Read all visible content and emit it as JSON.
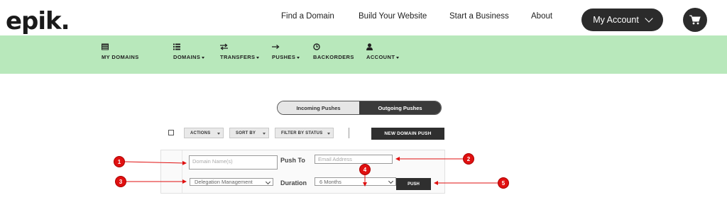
{
  "header": {
    "logo": "epik.",
    "nav": [
      "Find a Domain",
      "Build Your Website",
      "Start a Business",
      "About"
    ],
    "account_label": "My Account"
  },
  "band": {
    "items": [
      {
        "label": "MY DOMAINS",
        "icon": "list-icon",
        "dropdown": false
      },
      {
        "label": "DOMAINS",
        "icon": "list-icon",
        "dropdown": true
      },
      {
        "label": "TRANSFERS",
        "icon": "transfer-icon",
        "dropdown": true
      },
      {
        "label": "PUSHES",
        "icon": "arrow-right-icon",
        "dropdown": true
      },
      {
        "label": "BACKORDERS",
        "icon": "clock-icon",
        "dropdown": false
      },
      {
        "label": "ACCOUNT",
        "icon": "user-icon",
        "dropdown": true
      }
    ]
  },
  "tabs": {
    "incoming": "Incoming Pushes",
    "outgoing": "Outgoing Pushes"
  },
  "toolbar": {
    "actions": "ACTIONS",
    "sort_by": "SORT BY",
    "filter": "FILTER BY STATUS",
    "new_push": "NEW DOMAIN PUSH"
  },
  "form": {
    "domain_placeholder": "Domain Name(s)",
    "push_to_label": "Push To",
    "email_placeholder": "Email Address",
    "delegation_value": "Delegation Management",
    "duration_label": "Duration",
    "duration_value": "6 Months",
    "push_label": "PUSH"
  },
  "callouts": [
    "1",
    "2",
    "3",
    "4",
    "5"
  ],
  "colors": {
    "band": "#b8e8bb",
    "dark": "#2b2b2b",
    "callout": "#e01010"
  }
}
